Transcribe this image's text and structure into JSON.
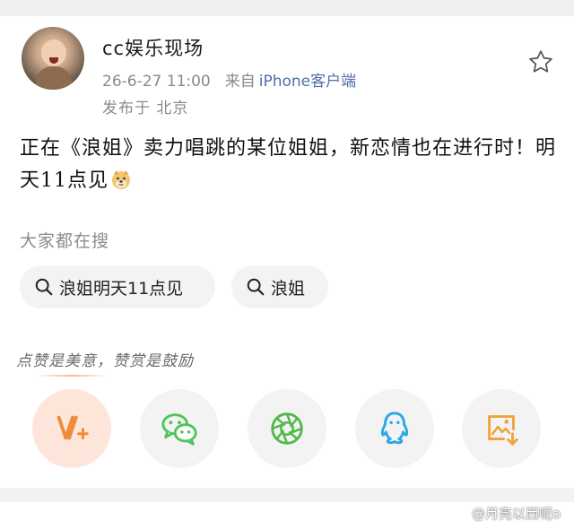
{
  "post": {
    "username": "cc娱乐现场",
    "timestamp": "26-6-27 11:00",
    "source_prefix": "来自",
    "source_app": "iPhone客户端",
    "location": "发布于 北京",
    "content": "正在《浪姐》卖力唱跳的某位姐姐，新恋情也在进行时！明天11点见",
    "emoji_icon": "doge-emoji"
  },
  "search": {
    "label": "大家都在搜",
    "chips": [
      {
        "label": "浪姐明天11点见"
      },
      {
        "label": "浪姐"
      }
    ]
  },
  "reward": {
    "tip": "点赞是美意，赞赏是鼓励"
  },
  "share_targets": [
    {
      "icon": "vplus-icon",
      "color": "#f08a3c"
    },
    {
      "icon": "wechat-icon",
      "color": "#4fc45a"
    },
    {
      "icon": "moments-icon",
      "color": "#52b848"
    },
    {
      "icon": "qq-icon",
      "color": "#2aa8e6"
    },
    {
      "icon": "save-image-icon",
      "color": "#f0a23c"
    }
  ],
  "watermark": {
    "text": "@月亮以西呢o"
  },
  "colors": {
    "accent_link": "#4d6fa8",
    "meta_gray": "#8a8a8a",
    "star_outline": "#555555"
  }
}
